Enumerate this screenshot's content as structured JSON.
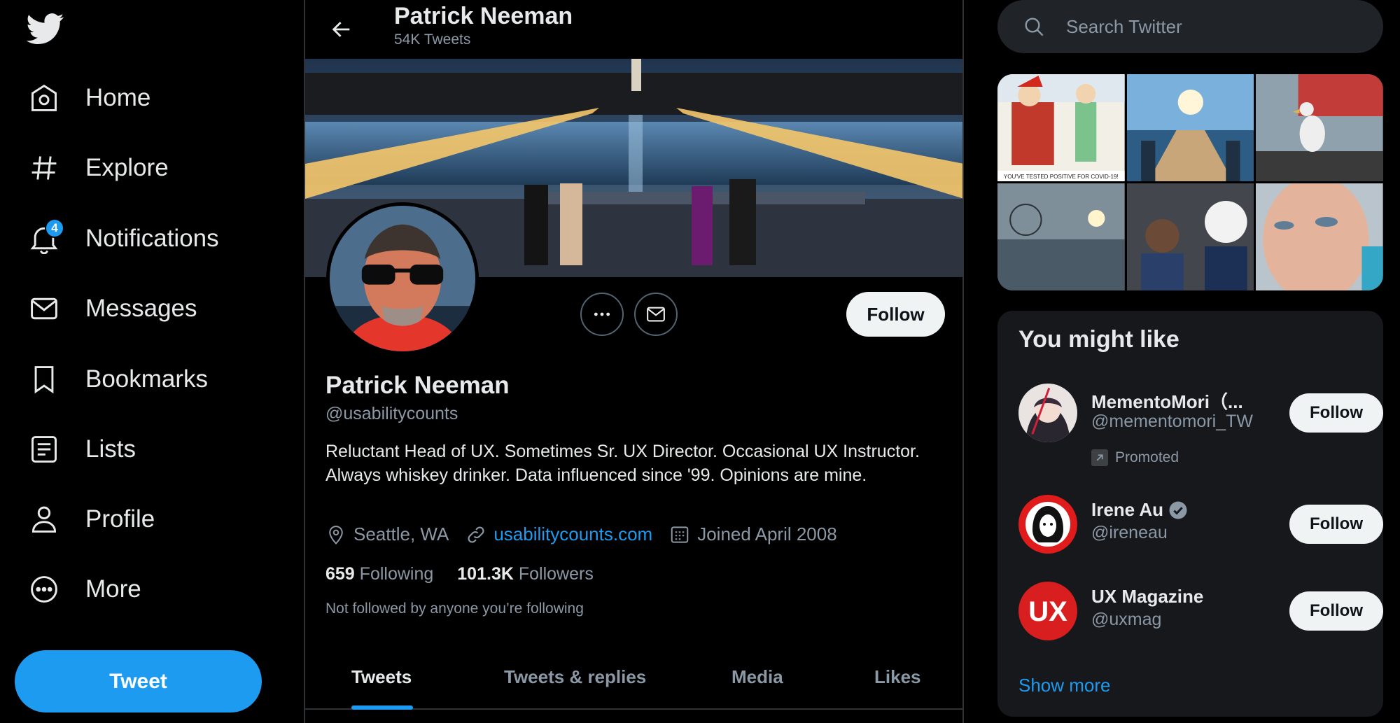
{
  "nav": {
    "items": [
      {
        "label": "Home",
        "icon": "home-icon"
      },
      {
        "label": "Explore",
        "icon": "hashtag-icon"
      },
      {
        "label": "Notifications",
        "icon": "bell-icon",
        "badge": "4"
      },
      {
        "label": "Messages",
        "icon": "envelope-icon"
      },
      {
        "label": "Bookmarks",
        "icon": "bookmark-icon"
      },
      {
        "label": "Lists",
        "icon": "list-icon"
      },
      {
        "label": "Profile",
        "icon": "person-icon"
      },
      {
        "label": "More",
        "icon": "more-circle-icon"
      }
    ],
    "tweet_label": "Tweet"
  },
  "header": {
    "name": "Patrick Neeman",
    "tweet_count": "54K Tweets"
  },
  "profile": {
    "name": "Patrick Neeman",
    "handle": "@usabilitycounts",
    "bio": "Reluctant Head of UX. Sometimes Sr. UX Director. Occasional UX Instructor. Always whiskey drinker. Data influenced since '99. Opinions are mine.",
    "location": "Seattle, WA",
    "website": "usabilitycounts.com",
    "joined": "Joined April 2008",
    "following_count": "659",
    "following_label": "Following",
    "followers_count": "101.3K",
    "followers_label": "Followers",
    "not_followed": "Not followed by anyone you’re following",
    "follow_label": "Follow"
  },
  "tabs": [
    {
      "label": "Tweets",
      "active": true
    },
    {
      "label": "Tweets & replies",
      "active": false
    },
    {
      "label": "Media",
      "active": false
    },
    {
      "label": "Likes",
      "active": false
    }
  ],
  "search": {
    "placeholder": "Search Twitter"
  },
  "media_caption": "YOU'VE TESTED POSITIVE FOR COVID-19!",
  "suggestions": {
    "title": "You might like",
    "items": [
      {
        "name": "MementoMori（...",
        "handle": "@mementomori_TW",
        "promoted": "Promoted",
        "follow": "Follow"
      },
      {
        "name": "Irene Au",
        "handle": "@ireneau",
        "verified": true,
        "follow": "Follow"
      },
      {
        "name": "UX Magazine",
        "handle": "@uxmag",
        "avatar_text": "UX",
        "follow": "Follow"
      }
    ],
    "show_more": "Show more"
  },
  "colors": {
    "accent": "#1d9bf0",
    "background": "#000000",
    "card": "#16181c",
    "muted_text": "#8b98a5"
  }
}
